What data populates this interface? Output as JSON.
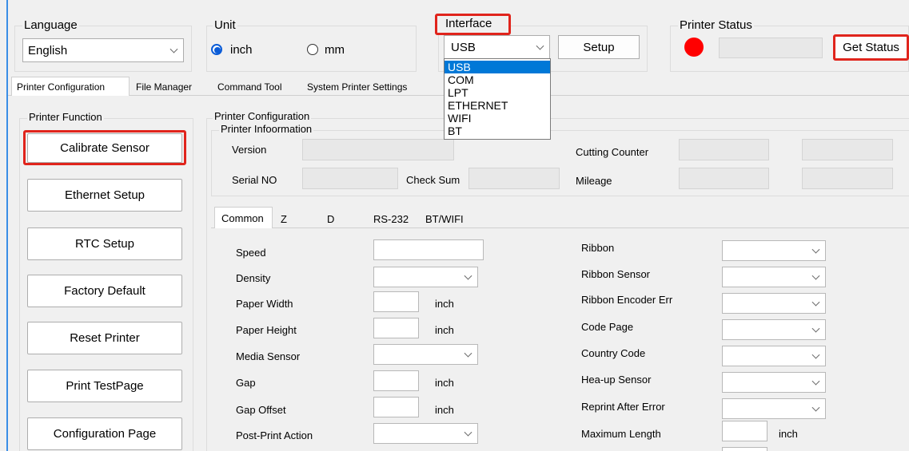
{
  "top": {
    "language": {
      "title": "Language",
      "value": "English"
    },
    "unit": {
      "title": "Unit",
      "inch": "inch",
      "mm": "mm",
      "selected": "inch"
    },
    "interface": {
      "title": "Interface",
      "value": "USB",
      "setup": "Setup",
      "options": [
        "USB",
        "COM",
        "LPT",
        "ETHERNET",
        "WIFI",
        "BT"
      ]
    },
    "printer_status": {
      "title": "Printer Status",
      "button": "Get Status",
      "indicator_color": "#ff0000"
    }
  },
  "tabs": [
    "Printer Configuration",
    "File Manager",
    "Command Tool",
    "System Printer Settings"
  ],
  "printer_function": {
    "title": "Printer Function",
    "buttons": [
      "Calibrate Sensor",
      "Ethernet Setup",
      "RTC Setup",
      "Factory Default",
      "Reset Printer",
      "Print TestPage",
      "Configuration Page"
    ]
  },
  "config": {
    "title": "Printer Configuration",
    "info_title": "Printer Infoormation",
    "version": "Version",
    "serial": "Serial NO",
    "checksum": "Check Sum",
    "cutting_counter": "Cutting Counter",
    "mileage": "Mileage",
    "subtabs": [
      "Common",
      "Z",
      "D",
      "RS-232",
      "BT/WIFI"
    ],
    "left_fields": {
      "speed": "Speed",
      "density": "Density",
      "paper_width": "Paper Width",
      "paper_height": "Paper Height",
      "media_sensor": "Media Sensor",
      "gap": "Gap",
      "gap_offset": "Gap Offset",
      "post_print": "Post-Print  Action"
    },
    "right_fields": {
      "ribbon": "Ribbon",
      "ribbon_sensor": "Ribbon  Sensor",
      "ribbon_encoder": "Ribbon Encoder Err",
      "code_page": "Code Page",
      "country_code": "Country Code",
      "head_up": "Hea-up  Sensor",
      "reprint": "Reprint After  Error",
      "max_length": "Maximum Length"
    },
    "unit_inch": "inch"
  },
  "colors": {
    "highlight": "#e0241c",
    "selection": "#0078d7"
  }
}
